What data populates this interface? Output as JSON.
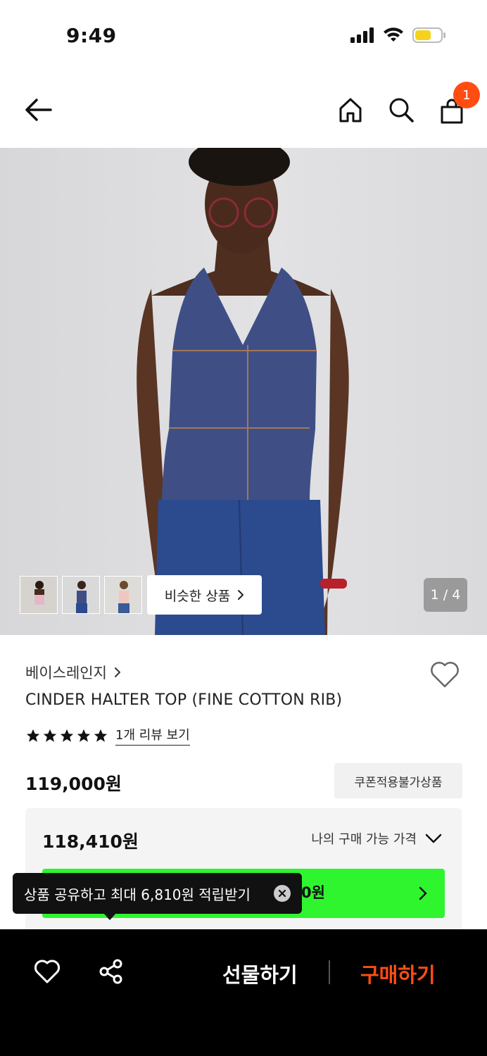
{
  "status": {
    "time": "9:49"
  },
  "nav": {
    "cart_count": "1"
  },
  "gallery": {
    "similar_label": "비슷한 상품",
    "page_indicator": "1 / 4"
  },
  "product": {
    "brand": "베이스레인지",
    "name": "CINDER HALTER TOP (FINE COTTON RIB)",
    "rating": 5,
    "review_link": "1개 리뷰 보기",
    "price": "119,000원",
    "coupon_tag": "쿠폰적용불가상품"
  },
  "my_price": {
    "value": "118,410원",
    "label": "나의 구매 가능 가격",
    "button_text": "0원"
  },
  "tooltip": {
    "text": "상품 공유하고 최대 6,810원 적립받기"
  },
  "bottom": {
    "gift_label": "선물하기",
    "buy_label": "구매하기"
  },
  "colors": {
    "accent": "#ff4d12",
    "green": "#2ff52f"
  }
}
